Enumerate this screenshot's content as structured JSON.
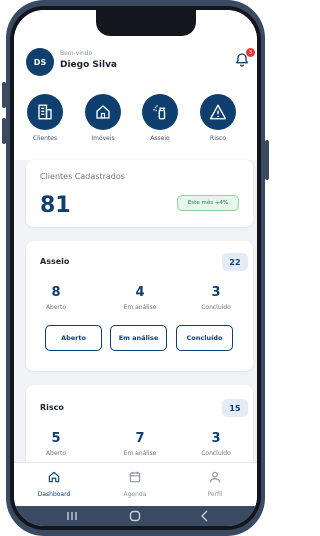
{
  "header": {
    "avatar_initials": "DS",
    "welcome": "Bem-vindo",
    "user_name": "Diego Silva",
    "notification_count": "3"
  },
  "quick_actions": [
    {
      "label": "Clientes",
      "icon": "building-icon"
    },
    {
      "label": "Imóveis",
      "icon": "house-icon"
    },
    {
      "label": "Asseio",
      "icon": "spray-bottle-icon"
    },
    {
      "label": "Risco",
      "icon": "warning-icon"
    }
  ],
  "clients_card": {
    "title": "Clientes Cadastrados",
    "value": "81",
    "trend": "Este mês +4%"
  },
  "asseio_card": {
    "title": "Asseio",
    "total": "22",
    "stats": [
      {
        "value": "8",
        "label": "Aberto"
      },
      {
        "value": "4",
        "label": "Em análise"
      },
      {
        "value": "3",
        "label": "Concluído"
      }
    ],
    "buttons": [
      "Aberto",
      "Em análise",
      "Concluído"
    ]
  },
  "risco_card": {
    "title": "Risco",
    "total": "15",
    "stats": [
      {
        "value": "5",
        "label": "Aberto"
      },
      {
        "value": "7",
        "label": "Em análise"
      },
      {
        "value": "3",
        "label": "Concluído"
      }
    ]
  },
  "tabbar": {
    "tabs": [
      {
        "label": "Dashboard",
        "icon": "home-icon",
        "active": true
      },
      {
        "label": "Agenda",
        "icon": "calendar-icon",
        "active": false
      },
      {
        "label": "Perfil",
        "icon": "user-icon",
        "active": false
      }
    ]
  },
  "colors": {
    "primary": "#0f3f6e",
    "frame": "#3b4a63",
    "badge": "#e53935",
    "success": "#2f7d46"
  }
}
